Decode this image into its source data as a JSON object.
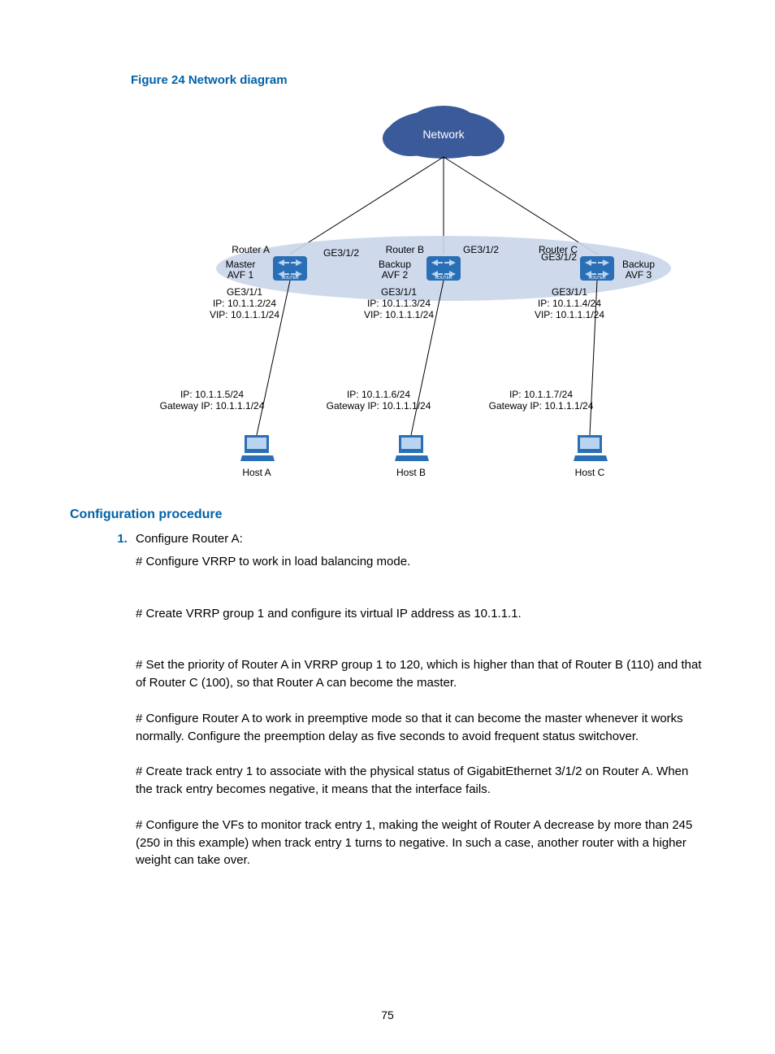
{
  "figure": {
    "caption": "Figure 24 Network diagram",
    "cloud_label": "Network",
    "routers": [
      {
        "name": "Router A",
        "role": "Master\nAVF 1",
        "uplink": "GE3/1/2",
        "downlink": "GE3/1/1",
        "ip": "IP: 10.1.1.2/24",
        "vip": "VIP: 10.1.1.1/24"
      },
      {
        "name": "Router B",
        "role": "Backup\nAVF 2",
        "uplink": "GE3/1/2",
        "downlink": "GE3/1/1",
        "ip": "IP: 10.1.1.3/24",
        "vip": "VIP: 10.1.1.1/24"
      },
      {
        "name": "Router C",
        "role": "Backup\nAVF 3",
        "uplink": "GE3/1/2",
        "downlink": "GE3/1/1",
        "ip": "IP: 10.1.1.4/24",
        "vip": "VIP: 10.1.1.1/24"
      }
    ],
    "hosts": [
      {
        "name": "Host A",
        "ip": "IP: 10.1.1.5/24",
        "gw": "Gateway IP: 10.1.1.1/24"
      },
      {
        "name": "Host B",
        "ip": "IP: 10.1.1.6/24",
        "gw": "Gateway IP: 10.1.1.1/24"
      },
      {
        "name": "Host C",
        "ip": "IP: 10.1.1.7/24",
        "gw": "Gateway IP: 10.1.1.1/24"
      }
    ],
    "router_badge": "ROUTER"
  },
  "section_heading": "Configuration procedure",
  "steps": [
    {
      "title": "Configure Router A:",
      "paras": [
        "# Configure VRRP to work in load balancing mode.",
        "# Create VRRP group 1 and configure its virtual IP address as 10.1.1.1.",
        "# Set the priority of Router A in VRRP group 1 to 120, which is higher than that of Router B (110) and that of Router C (100), so that Router A can become the master.",
        "# Configure Router A to work in preemptive mode so that it can become the master whenever it works normally. Configure the preemption delay as five seconds to avoid frequent status switchover.",
        "# Create track entry 1 to associate with the physical status of GigabitEthernet 3/1/2 on Router A. When the track entry becomes negative, it means that the interface fails.",
        "# Configure the VFs to monitor track entry 1, making the weight of Router A decrease by more than 245 (250 in this example) when track entry 1 turns to negative. In such a case, another router with a higher weight can take over."
      ]
    }
  ],
  "page_number": "75"
}
